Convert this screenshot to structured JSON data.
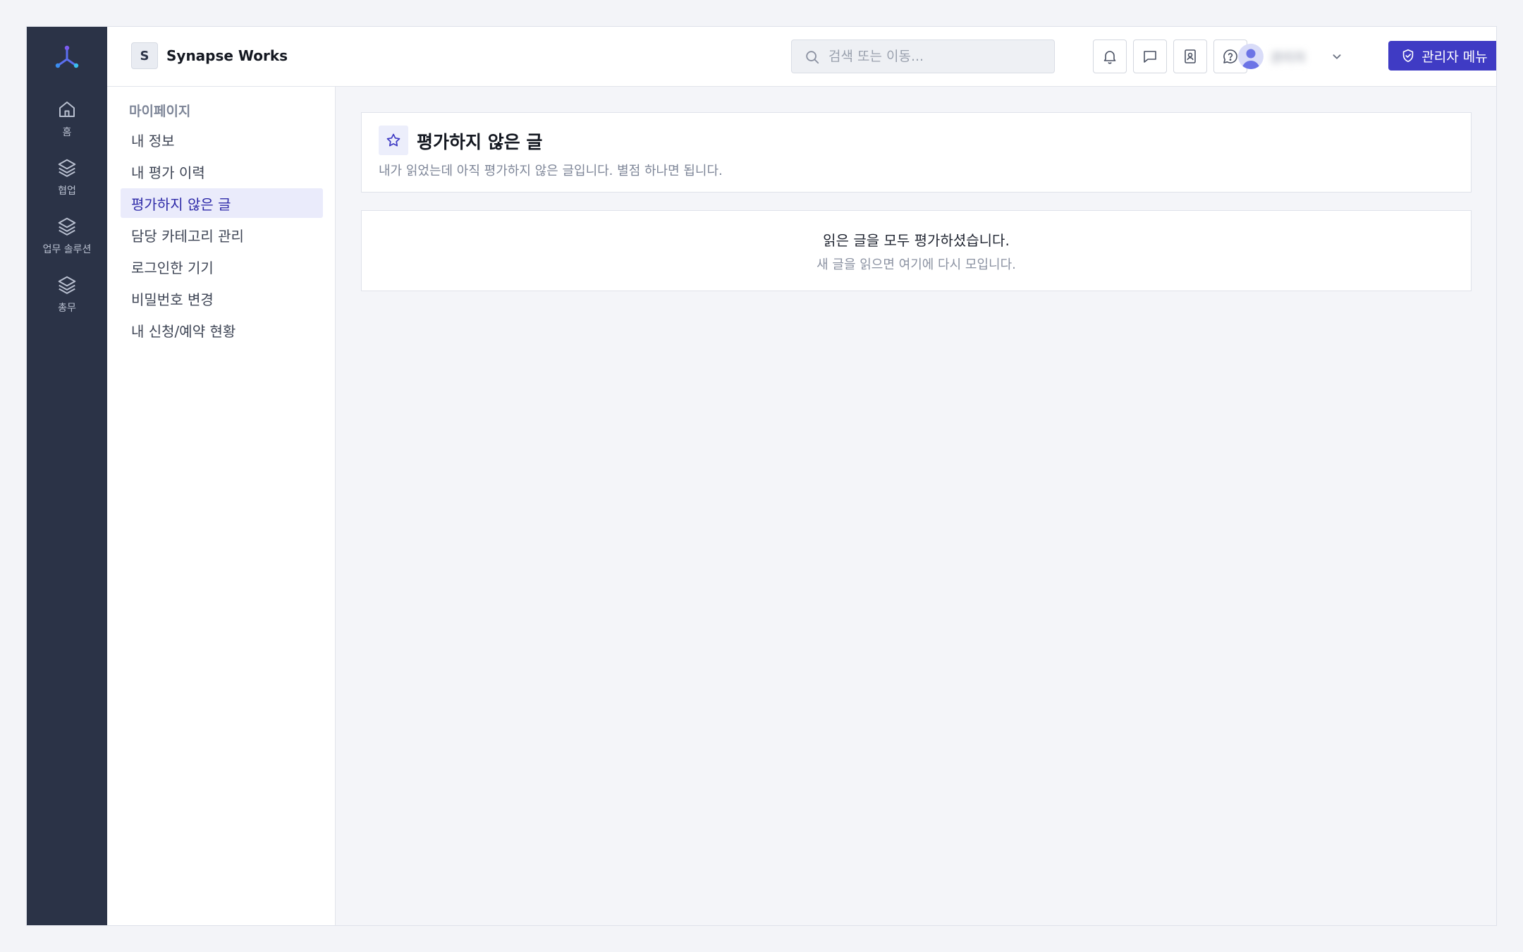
{
  "header": {
    "workspace_initial": "S",
    "workspace_name": "Synapse Works",
    "search_placeholder": "검색 또는 이동...",
    "user_name": "관리자",
    "admin_button_label": "관리자 메뉴"
  },
  "rail": {
    "items": [
      {
        "label": "홈",
        "icon": "home-icon"
      },
      {
        "label": "협업",
        "icon": "layers-icon"
      },
      {
        "label": "업무 솔루션",
        "icon": "layers-icon"
      },
      {
        "label": "총무",
        "icon": "layers-icon"
      }
    ]
  },
  "subnav": {
    "title": "마이페이지",
    "items": [
      {
        "label": "내 정보",
        "active": false
      },
      {
        "label": "내 평가 이력",
        "active": false
      },
      {
        "label": "평가하지 않은 글",
        "active": true
      },
      {
        "label": "담당 카테고리 관리",
        "active": false
      },
      {
        "label": "로그인한 기기",
        "active": false
      },
      {
        "label": "비밀번호 변경",
        "active": false
      },
      {
        "label": "내 신청/예약 현황",
        "active": false
      }
    ]
  },
  "main": {
    "title": "평가하지 않은 글",
    "subtitle": "내가 읽었는데 아직 평가하지 않은 글입니다. 별점 하나면 됩니다.",
    "empty_title": "읽은 글을 모두 평가하셨습니다.",
    "empty_subtitle": "새 글을 읽으면 여기에 다시 모입니다."
  },
  "colors": {
    "rail_bg": "#2b3347",
    "accent": "#3f3bc4",
    "active_bg": "#eaebfb"
  }
}
